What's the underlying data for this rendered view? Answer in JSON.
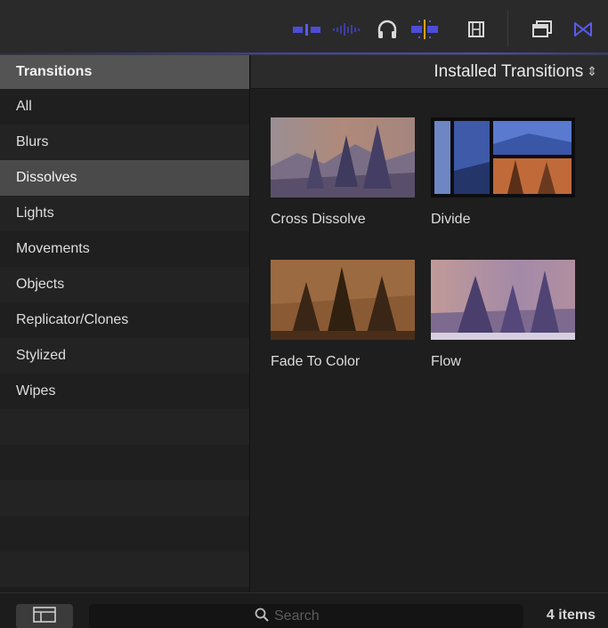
{
  "toolbar": {
    "icons": [
      "clip-connection-icon",
      "audio-waveform-icon",
      "headphones-icon",
      "skimming-icon",
      "filmstrip-icon",
      "window-layout-icon",
      "transitions-browser-icon"
    ],
    "accent_color": "#5a5af0"
  },
  "sidebar": {
    "header": "Transitions",
    "items": [
      {
        "label": "All"
      },
      {
        "label": "Blurs"
      },
      {
        "label": "Dissolves"
      },
      {
        "label": "Lights"
      },
      {
        "label": "Movements"
      },
      {
        "label": "Objects"
      },
      {
        "label": "Replicator/Clones"
      },
      {
        "label": "Stylized"
      },
      {
        "label": "Wipes"
      }
    ],
    "selected": "Dissolves"
  },
  "main": {
    "header": "Installed Transitions",
    "tiles": [
      {
        "label": "Cross Dissolve"
      },
      {
        "label": "Divide"
      },
      {
        "label": "Fade To Color"
      },
      {
        "label": "Flow"
      }
    ]
  },
  "bottom": {
    "search_placeholder": "Search",
    "items_count": "4 items"
  }
}
